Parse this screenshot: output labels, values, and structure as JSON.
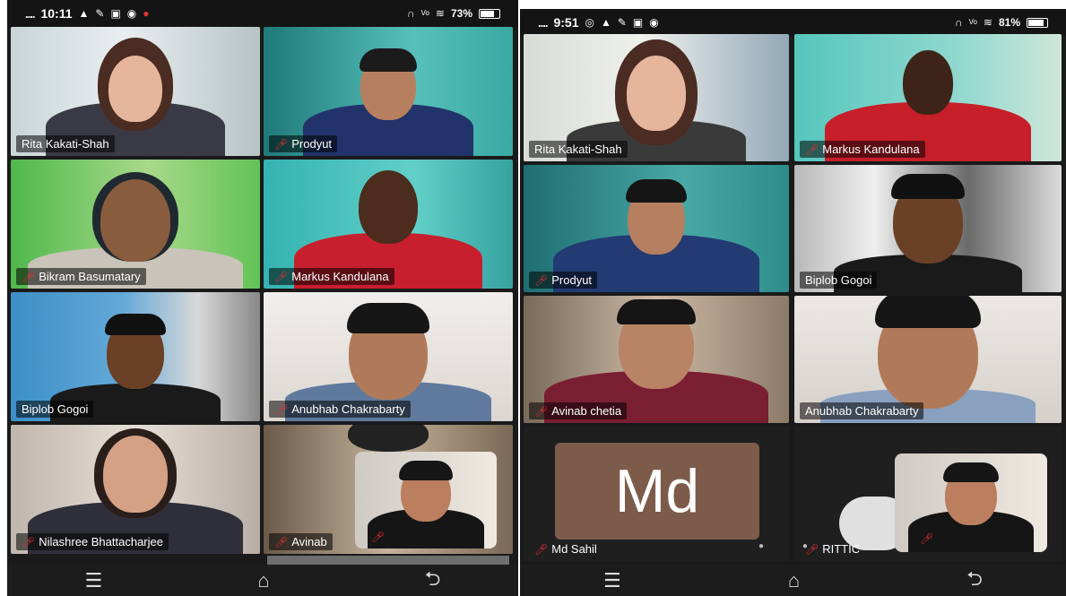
{
  "left_phone": {
    "status": {
      "signal": "....",
      "time": "10:11",
      "battery": "73%"
    },
    "tiles": [
      {
        "name": "Rita Kakati-Shah",
        "muted": false,
        "active": true
      },
      {
        "name": "Prodyut",
        "muted": true
      },
      {
        "name": "Bikram Basumatary",
        "muted": true
      },
      {
        "name": "Markus Kandulana",
        "muted": true
      },
      {
        "name": "Biplob Gogoi",
        "muted": false
      },
      {
        "name": "Anubhab Chakrabarty",
        "muted": true
      },
      {
        "name": "Nilashree Bhattacharjee",
        "muted": true
      },
      {
        "name": "Avinab",
        "muted": true
      }
    ]
  },
  "right_phone": {
    "status": {
      "signal": "....",
      "time": "9:51",
      "battery": "81%"
    },
    "tiles": [
      {
        "name": "Rita Kakati-Shah",
        "muted": false,
        "active": true
      },
      {
        "name": "Markus Kandulana",
        "muted": true
      },
      {
        "name": "Prodyut",
        "muted": true
      },
      {
        "name": "Biplob Gogoi",
        "muted": false
      },
      {
        "name": "Avinab chetia",
        "muted": true
      },
      {
        "name": "Anubhab Chakrabarty",
        "muted": false
      },
      {
        "name": "Md Sahil",
        "muted": true,
        "avatar_text": "Md"
      },
      {
        "name": "RITTIC",
        "muted": true
      }
    ]
  },
  "icons": {
    "menu": "hamburger-icon",
    "home": "home-icon",
    "back": "back-icon"
  }
}
